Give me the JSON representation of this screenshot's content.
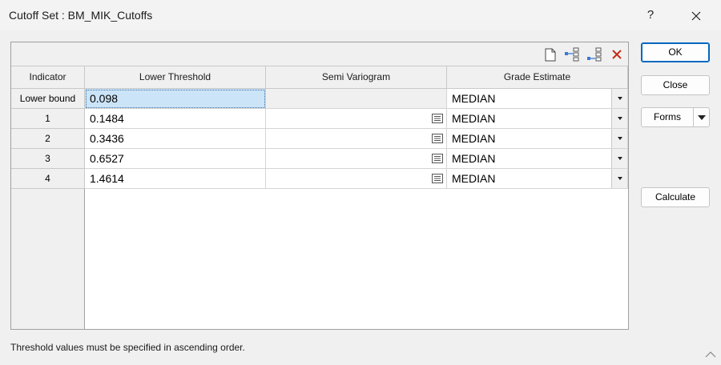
{
  "window": {
    "title": "Cutoff Set : BM_MIK_Cutoffs",
    "help_label": "?",
    "close_icon": "close-icon"
  },
  "toolbar": {
    "icons": [
      "new-document-icon",
      "insert-row-icon",
      "append-row-icon",
      "delete-icon"
    ],
    "delete_color": "#c42b1c"
  },
  "grid": {
    "headers": {
      "indicator": "Indicator",
      "lower_threshold": "Lower Threshold",
      "semi_variogram": "Semi Variogram",
      "grade_estimate": "Grade Estimate"
    },
    "rows": [
      {
        "indicator": "Lower bound",
        "lower_threshold": "0.098",
        "semi_variogram": "",
        "grade_estimate": "MEDIAN"
      },
      {
        "indicator": "1",
        "lower_threshold": "0.1484",
        "semi_variogram": "",
        "grade_estimate": "MEDIAN"
      },
      {
        "indicator": "2",
        "lower_threshold": "0.3436",
        "semi_variogram": "",
        "grade_estimate": "MEDIAN"
      },
      {
        "indicator": "3",
        "lower_threshold": "0.6527",
        "semi_variogram": "",
        "grade_estimate": "MEDIAN"
      },
      {
        "indicator": "4",
        "lower_threshold": "1.4614",
        "semi_variogram": "",
        "grade_estimate": "MEDIAN"
      }
    ]
  },
  "buttons": {
    "ok": "OK",
    "close": "Close",
    "forms": "Forms",
    "calculate": "Calculate"
  },
  "status": {
    "message": "Threshold values must be specified in ascending order."
  },
  "colors": {
    "selection": "#cce4f7",
    "accent": "#0067c0"
  }
}
